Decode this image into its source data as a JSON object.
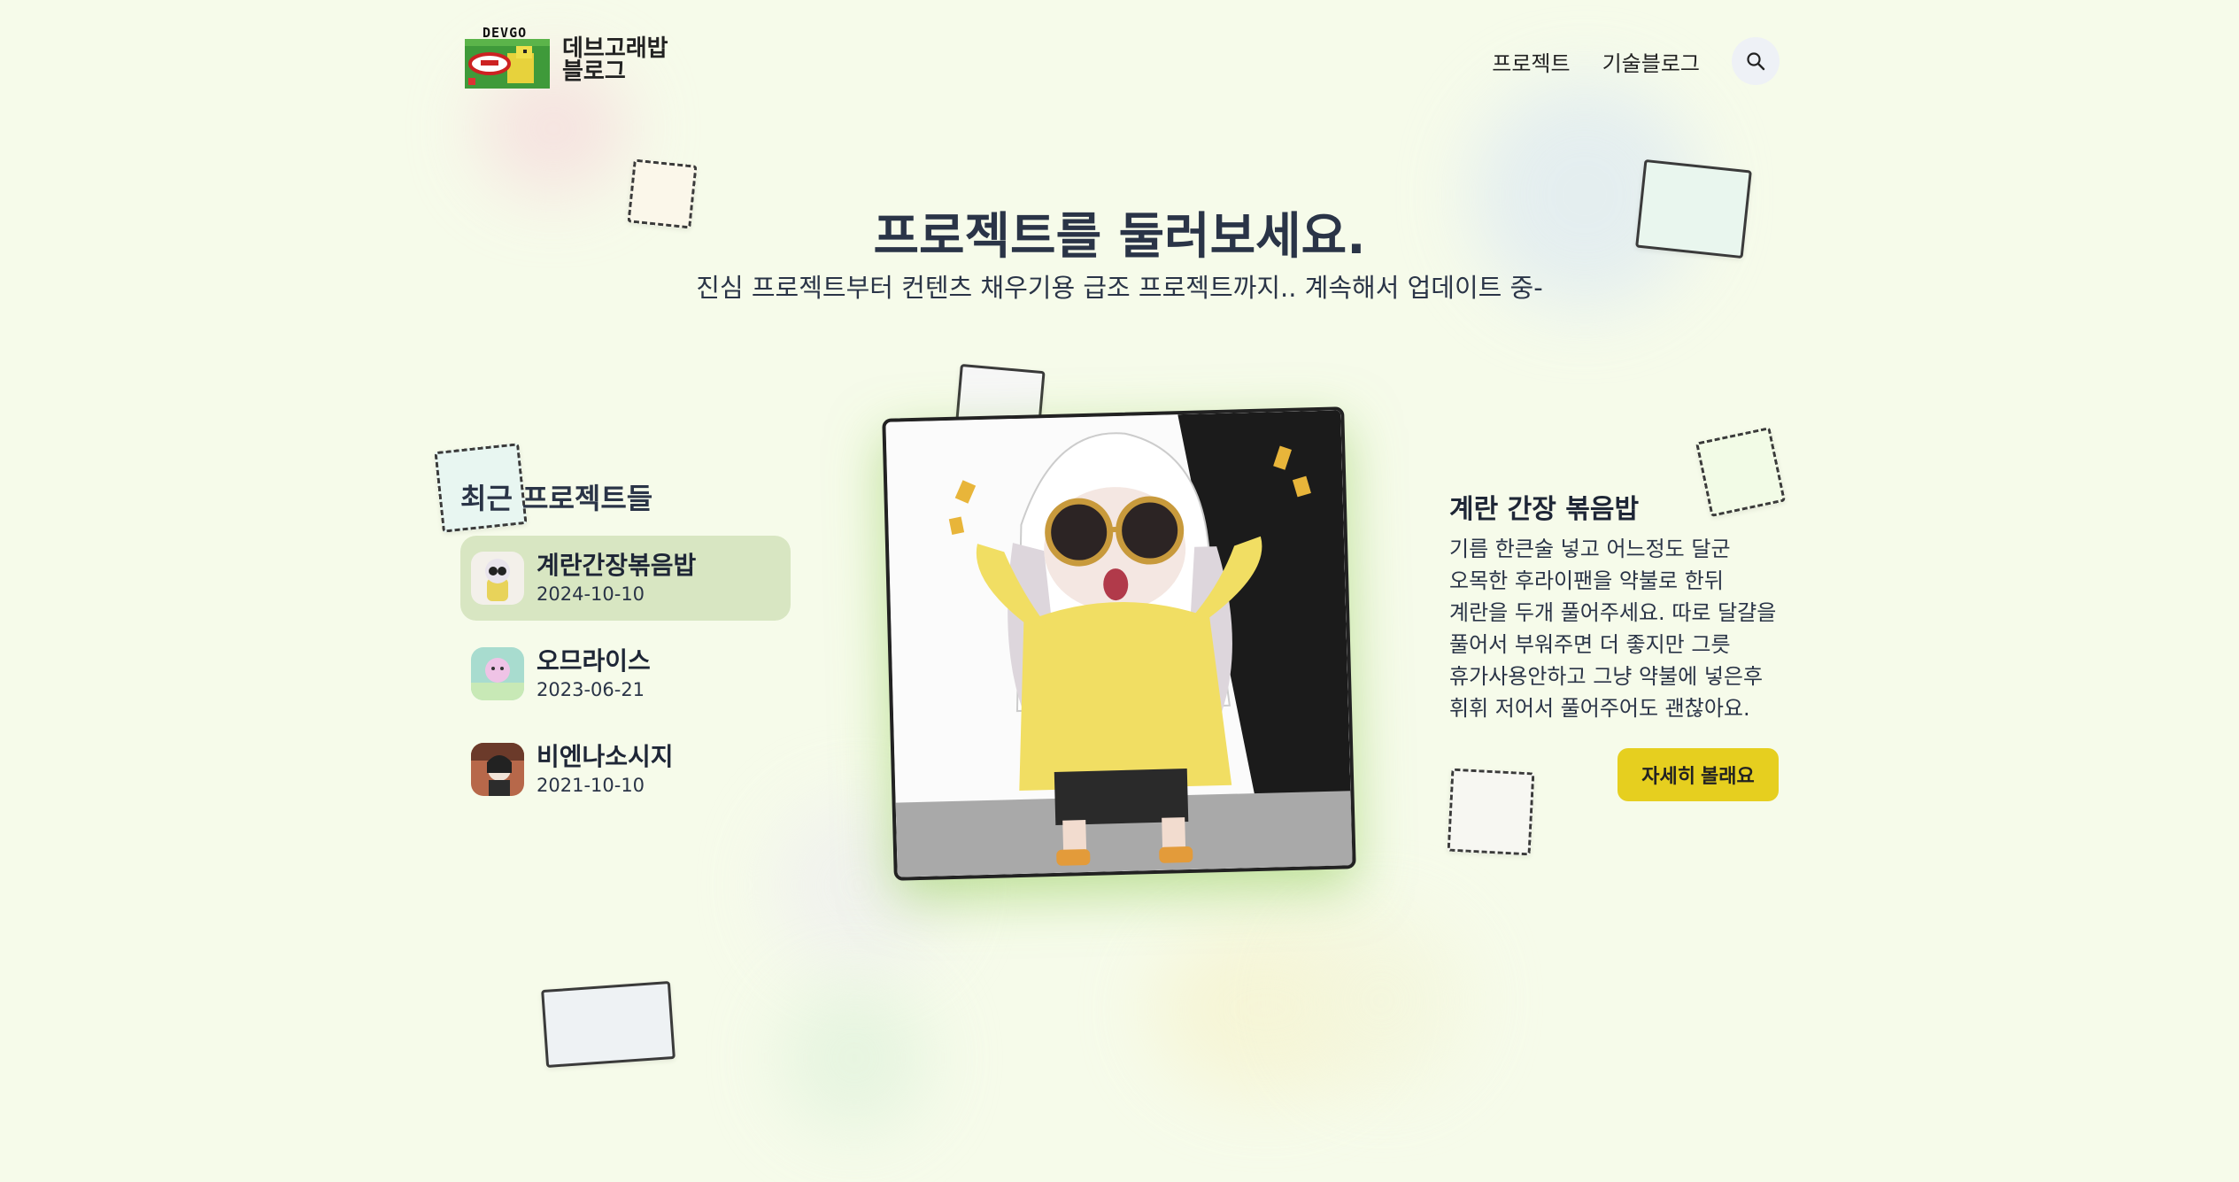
{
  "header": {
    "logo_badge": "DEVGO",
    "logo_text": "데브고래밥 블로그",
    "nav": [
      "프로젝트",
      "기술블로그"
    ],
    "search_icon": "search-icon"
  },
  "hero": {
    "title": "프로젝트를 둘러보세요.",
    "subtitle": "진심 프로젝트부터 컨텐츠 채우기용 급조 프로젝트까지.. 계속해서 업데이트 중-"
  },
  "projects": {
    "heading": "최근 프로젝트들",
    "items": [
      {
        "title": "계란간장볶음밥",
        "date": "2024-10-10",
        "active": true
      },
      {
        "title": "오므라이스",
        "date": "2023-06-21",
        "active": false
      },
      {
        "title": "비엔나소시지",
        "date": "2021-10-10",
        "active": false
      }
    ]
  },
  "detail": {
    "title": "계란 간장 볶음밥",
    "description": "기름 한큰술 넣고 어느정도 달군 오목한 후라이팬을 약불로 한뒤 계란을 두개 풀어주세요. 따로 달걀을 풀어서 부워주면 더 좋지만 그릇 휴가사용안하고 그냥 약불에 넣은후 휘휘 저어서 풀어주어도 괜찮아요.",
    "button": "자세히 볼래요"
  },
  "colors": {
    "background": "#f6fbea",
    "accent_button": "#e6cf1f",
    "active_item": "#d8e6c2",
    "text": "#2a3447"
  }
}
